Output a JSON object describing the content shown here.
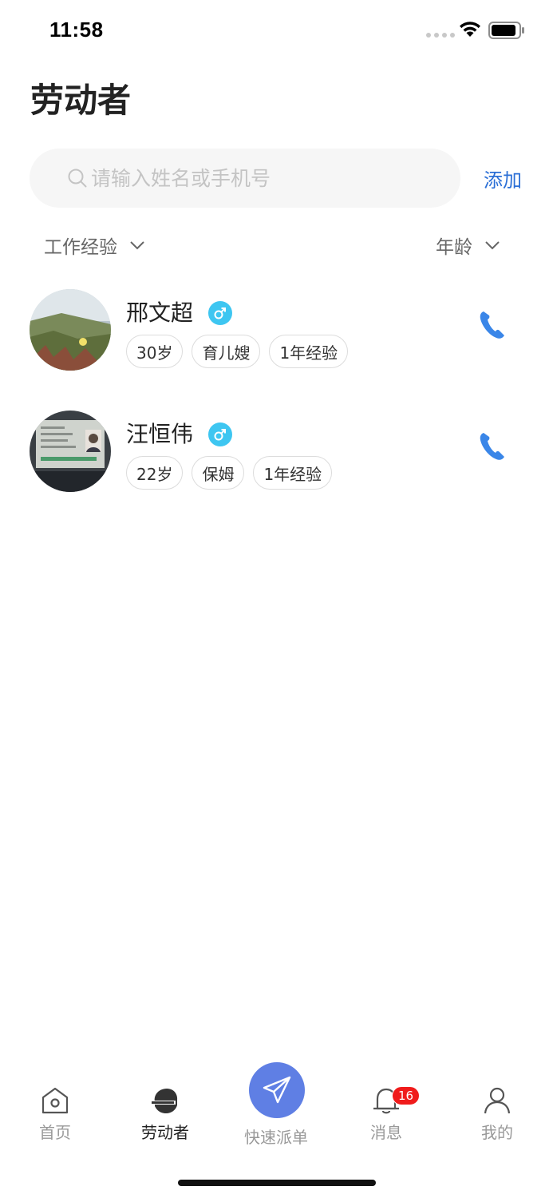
{
  "status": {
    "time": "11:58"
  },
  "page": {
    "title": "劳动者"
  },
  "search": {
    "placeholder": "请输入姓名或手机号",
    "value": "",
    "add_label": "添加"
  },
  "filters": {
    "experience_label": "工作经验",
    "age_label": "年龄"
  },
  "workers": [
    {
      "name": "邢文超",
      "gender": "male",
      "tags": [
        "30岁",
        "育儿嫂",
        "1年经验"
      ]
    },
    {
      "name": "汪恒伟",
      "gender": "male",
      "tags": [
        "22岁",
        "保姆",
        "1年经验"
      ]
    }
  ],
  "tabbar": {
    "items": [
      {
        "label": "首页",
        "icon": "home-icon"
      },
      {
        "label": "劳动者",
        "icon": "worker-icon",
        "active": true
      },
      {
        "label": "快速派单",
        "icon": "send-icon"
      },
      {
        "label": "消息",
        "icon": "bell-icon",
        "badge": "16"
      },
      {
        "label": "我的",
        "icon": "profile-icon"
      }
    ]
  },
  "colors": {
    "accent": "#2b6fd6",
    "phone": "#3a86e8",
    "gender_male": "#3ec6f1",
    "fab": "#5f7fe4",
    "badge": "#f01b1b"
  }
}
